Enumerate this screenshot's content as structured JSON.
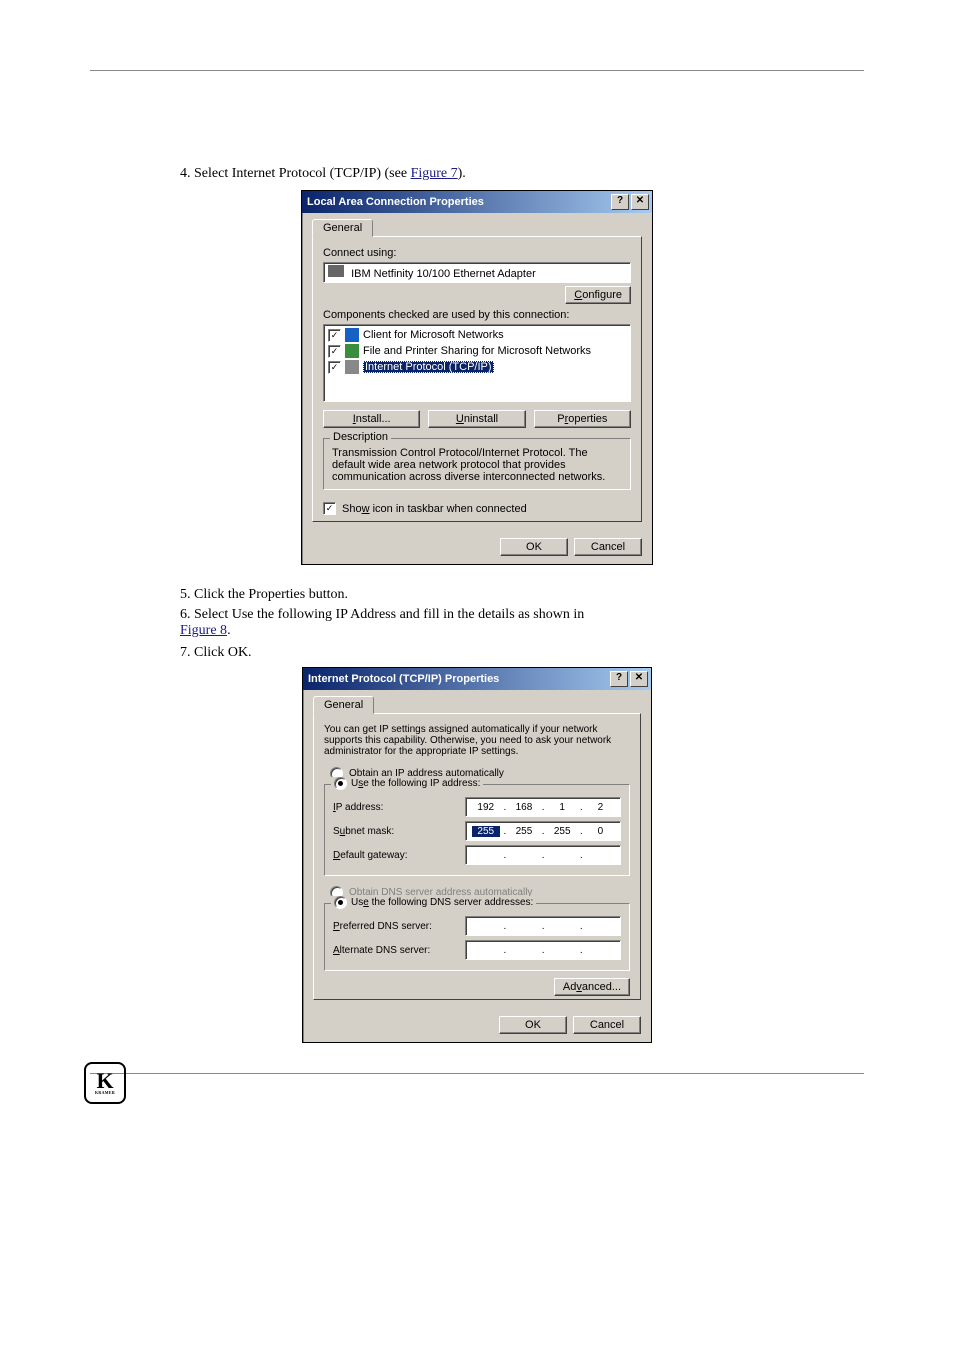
{
  "instructions": {
    "step4": "4. Select Internet Protocol (TCP/IP) (see ",
    "step4_link": "Figure 7",
    "step4_tail": ").",
    "step5": "5. Click the Properties button.",
    "step6": "6. Select Use the following IP Address and fill in the details as shown in",
    "step6_link": "Figure 8",
    "step6_tail": ".",
    "step7": "7. Click OK."
  },
  "dialog1": {
    "title": "Local Area Connection Properties",
    "tab": "General",
    "connect_using_label": "Connect using:",
    "adapter": "IBM Netfinity 10/100 Ethernet Adapter",
    "configure_btn": "Configure",
    "components_label": "Components checked are used by this connection:",
    "components": {
      "c1": "Client for Microsoft Networks",
      "c2": "File and Printer Sharing for Microsoft Networks",
      "c3": "Internet Protocol (TCP/IP)"
    },
    "buttons": {
      "install": "Install...",
      "uninstall": "Uninstall",
      "properties": "Properties"
    },
    "desc_header": "Description",
    "desc_text": "Transmission Control Protocol/Internet Protocol. The default wide area network protocol that provides communication across diverse interconnected networks.",
    "show_icon": "Show icon in taskbar when connected",
    "ok": "OK",
    "cancel": "Cancel"
  },
  "dialog2": {
    "title": "Internet Protocol (TCP/IP) Properties",
    "tab": "General",
    "intro": "You can get IP settings assigned automatically if your network supports this capability. Otherwise, you need to ask your network administrator for the appropriate IP settings.",
    "radio_auto_ip": "Obtain an IP address automatically",
    "radio_use_ip": "Use the following IP address:",
    "labels": {
      "ip": "IP address:",
      "subnet": "Subnet mask:",
      "gateway": "Default gateway:",
      "pref_dns": "Preferred DNS server:",
      "alt_dns": "Alternate DNS server:"
    },
    "ip_address": {
      "a": "192",
      "b": "168",
      "c": "1",
      "d": "2"
    },
    "subnet": {
      "a": "255",
      "b": "255",
      "c": "255",
      "d": "0"
    },
    "radio_auto_dns": "Obtain DNS server address automatically",
    "radio_use_dns": "Use the following DNS server addresses:",
    "advanced": "Advanced...",
    "ok": "OK",
    "cancel": "Cancel"
  },
  "logo_text": "K",
  "logo_sub": "KRAMER"
}
